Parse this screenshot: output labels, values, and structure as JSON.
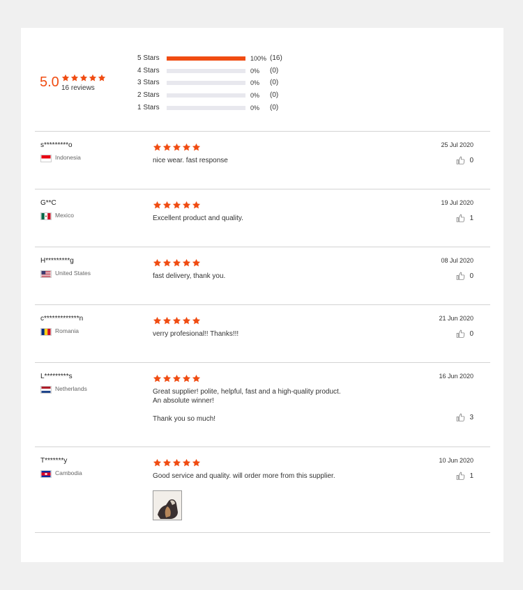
{
  "summary": {
    "average": "5.0",
    "review_count_label": "16 reviews",
    "distribution": [
      {
        "label": "5 Stars",
        "fraction": 1.0,
        "pct": "100%",
        "count": "(16)"
      },
      {
        "label": "4 Stars",
        "fraction": 0.0,
        "pct": "0%",
        "count": "(0)"
      },
      {
        "label": "3 Stars",
        "fraction": 0.0,
        "pct": "0%",
        "count": "(0)"
      },
      {
        "label": "2 Stars",
        "fraction": 0.0,
        "pct": "0%",
        "count": "(0)"
      },
      {
        "label": "1 Stars",
        "fraction": 0.0,
        "pct": "0%",
        "count": "(0)"
      }
    ]
  },
  "colors": {
    "accent": "#f04c12",
    "bar_track": "#e8e8ee",
    "divider": "#d3d3d3"
  },
  "icons": {
    "star": "star-icon",
    "thumb": "thumbs-up-icon"
  },
  "reviews": [
    {
      "reviewer": "s*********o",
      "country": "Indonesia",
      "flag": "flag-indonesia",
      "rating": 5,
      "text": [
        "nice wear. fast response"
      ],
      "date": "25 Jul 2020",
      "likes": "0",
      "has_photo": false
    },
    {
      "reviewer": "G**C",
      "country": "Mexico",
      "flag": "flag-mexico",
      "rating": 5,
      "text": [
        "Excellent product and quality."
      ],
      "date": "19 Jul 2020",
      "likes": "1",
      "has_photo": false
    },
    {
      "reviewer": "H*********g",
      "country": "United States",
      "flag": "flag-united-states",
      "rating": 5,
      "text": [
        "fast delivery, thank you."
      ],
      "date": "08 Jul 2020",
      "likes": "0",
      "has_photo": false
    },
    {
      "reviewer": "c*************n",
      "country": "Romania",
      "flag": "flag-romania",
      "rating": 5,
      "text": [
        "verry profesional!! Thanks!!!"
      ],
      "date": "21 Jun 2020",
      "likes": "0",
      "has_photo": false
    },
    {
      "reviewer": "L*********s",
      "country": "Netherlands",
      "flag": "flag-netherlands",
      "rating": 5,
      "text": [
        "Great supplier! polite, helpful, fast and a high-quality product.",
        "An absolute winner!",
        "",
        "Thank you so much!"
      ],
      "date": "16 Jun 2020",
      "likes": "3",
      "has_photo": false
    },
    {
      "reviewer": "T*******y",
      "country": "Cambodia",
      "flag": "flag-cambodia",
      "rating": 5,
      "text": [
        "Good service and quality.  will order more from this supplier."
      ],
      "date": "10 Jun 2020",
      "likes": "1",
      "has_photo": true
    }
  ]
}
